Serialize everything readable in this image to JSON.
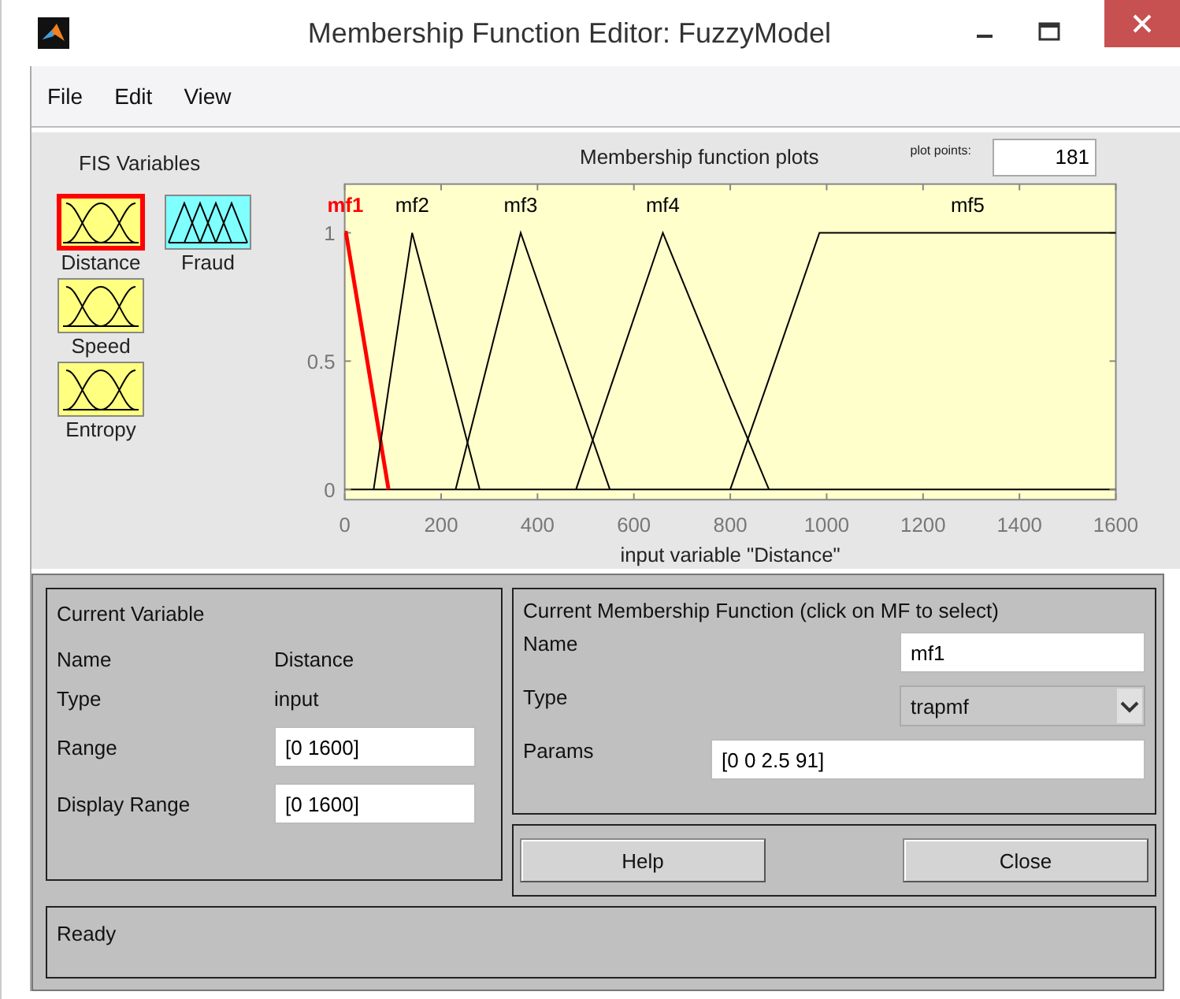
{
  "window": {
    "title": "Membership Function Editor: FuzzyModel"
  },
  "menu": [
    {
      "label": "File"
    },
    {
      "label": "Edit"
    },
    {
      "label": "View"
    }
  ],
  "fis_variables": {
    "title": "FIS Variables",
    "items": [
      {
        "name": "Distance",
        "kind": "input",
        "selected": true
      },
      {
        "name": "Fraud",
        "kind": "output",
        "selected": false
      },
      {
        "name": "Speed",
        "kind": "input",
        "selected": false
      },
      {
        "name": "Entropy",
        "kind": "input",
        "selected": false
      }
    ]
  },
  "plot": {
    "title": "Membership function plots",
    "plot_points_label": "plot points:",
    "plot_points": "181",
    "chart_data": {
      "type": "line",
      "xlabel": "input variable \"Distance\"",
      "xlim": [
        0,
        1600
      ],
      "ylim": [
        -0.04,
        1.19
      ],
      "xticks": [
        0,
        200,
        400,
        600,
        800,
        1000,
        1200,
        1400,
        1600
      ],
      "yticks": [
        0,
        0.5,
        1
      ],
      "x": [
        0,
        2.5,
        60,
        91,
        140,
        230,
        280,
        365,
        480,
        550,
        660,
        800,
        880,
        985,
        1600
      ],
      "series": [
        {
          "name": "mf1",
          "color": "#ff0000",
          "values": [
            1,
            1,
            0.35,
            0,
            null,
            null,
            null,
            null,
            null,
            null,
            null,
            null,
            null,
            null,
            null
          ]
        },
        {
          "name": "mf2",
          "color": "#000000",
          "values": [
            null,
            null,
            0,
            0.39,
            1,
            0.36,
            0,
            null,
            null,
            null,
            null,
            null,
            null,
            null,
            null
          ]
        },
        {
          "name": "mf3",
          "color": "#000000",
          "values": [
            null,
            null,
            null,
            null,
            null,
            0,
            0.37,
            1,
            0.38,
            0,
            null,
            null,
            null,
            null,
            null
          ]
        },
        {
          "name": "mf4",
          "color": "#000000",
          "values": [
            null,
            null,
            null,
            null,
            null,
            null,
            null,
            null,
            0,
            0.39,
            1,
            0.36,
            0,
            null,
            null
          ]
        },
        {
          "name": "mf5",
          "color": "#000000",
          "values": [
            null,
            null,
            null,
            null,
            null,
            null,
            null,
            null,
            null,
            null,
            null,
            0,
            0.43,
            1,
            1
          ]
        }
      ]
    }
  },
  "current_variable": {
    "title": "Current Variable",
    "name_label": "Name",
    "name": "Distance",
    "type_label": "Type",
    "type": "input",
    "range_label": "Range",
    "range": "[0 1600]",
    "display_range_label": "Display Range",
    "display_range": "[0 1600]"
  },
  "current_mf": {
    "title": "Current Membership Function (click on MF to select)",
    "name_label": "Name",
    "name": "mf1",
    "type_label": "Type",
    "type": "trapmf",
    "params_label": "Params",
    "params": "[0 0 2.5 91]"
  },
  "buttons": [
    {
      "label": "Help"
    },
    {
      "label": "Close"
    }
  ],
  "status_bar": "Ready"
}
